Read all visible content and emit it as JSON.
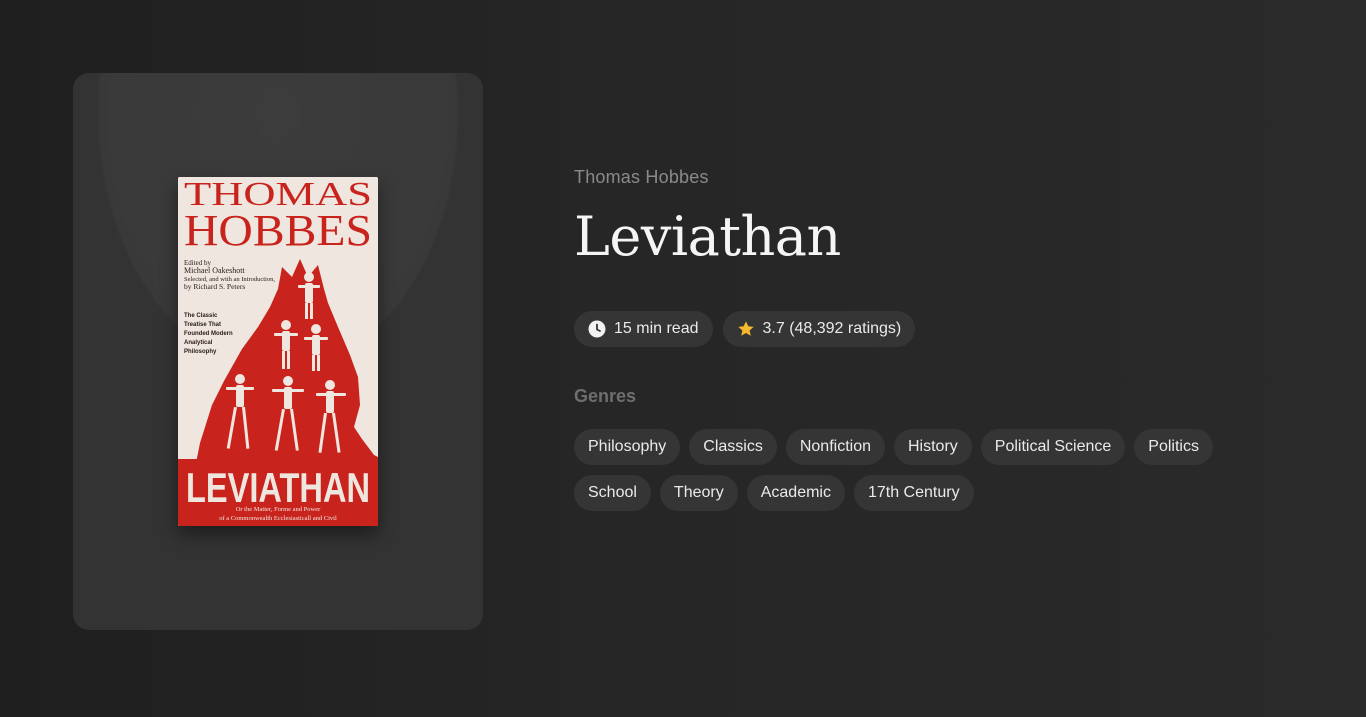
{
  "book": {
    "author": "Thomas Hobbes",
    "title": "Leviathan",
    "cover": {
      "line1": "THOMAS",
      "line2": "HOBBES",
      "edited_by": "Edited by",
      "editor": "Michael Oakeshott",
      "selected": "Selected, and with an Introduction,",
      "by": "by Richard S. Peters",
      "blurb": [
        "The Classic",
        "Treatise That",
        "Founded Modern",
        "Analytical",
        "Philosophy"
      ],
      "big_title": "LEVIATHAN",
      "subtitle1": "Or the Matter, Forme and Power",
      "subtitle2": "of a Commonwealth Ecclesiasticall and Civil",
      "colors": {
        "red": "#c8231c",
        "paper": "#efe6df"
      }
    }
  },
  "meta": {
    "read_time": "15 min read",
    "read_time_icon": "clock-icon",
    "rating": "3.7 (48,392 ratings)",
    "rating_icon": "star-icon",
    "star_color": "#f5b82e"
  },
  "genres": {
    "heading": "Genres",
    "items": [
      "Philosophy",
      "Classics",
      "Nonfiction",
      "History",
      "Political Science",
      "Politics",
      "School",
      "Theory",
      "Academic",
      "17th Century"
    ]
  }
}
